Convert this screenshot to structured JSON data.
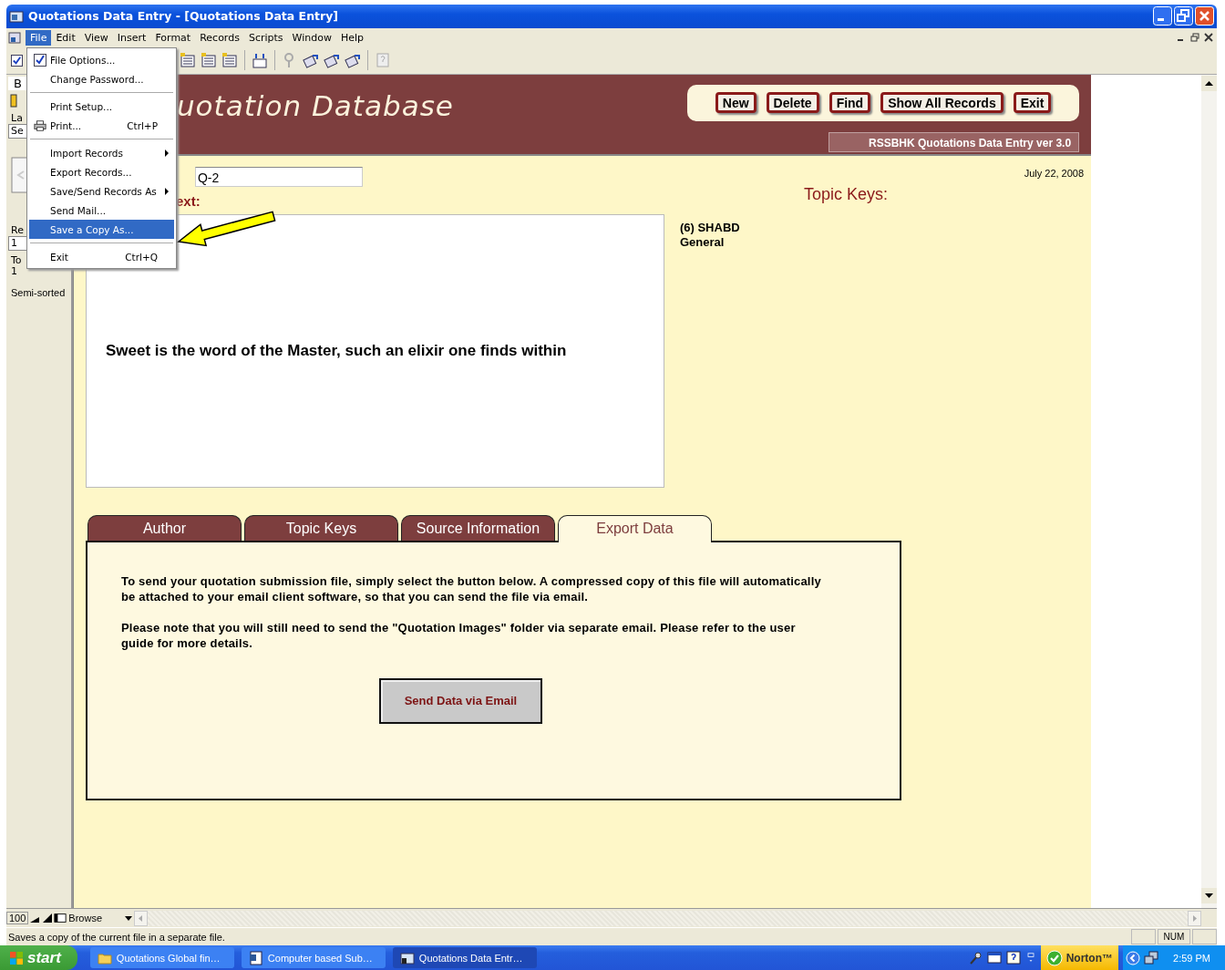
{
  "window": {
    "title": "Quotations Data Entry - [Quotations Data Entry]"
  },
  "menu_bar": [
    {
      "label": "File",
      "selected": true
    },
    {
      "label": "Edit",
      "selected": false
    },
    {
      "label": "View",
      "selected": false
    },
    {
      "label": "Insert",
      "selected": false
    },
    {
      "label": "Format",
      "selected": false
    },
    {
      "label": "Records",
      "selected": false
    },
    {
      "label": "Scripts",
      "selected": false
    },
    {
      "label": "Window",
      "selected": false
    },
    {
      "label": "Help",
      "selected": false
    }
  ],
  "file_menu": [
    {
      "kind": "check",
      "label": "File Options...",
      "checked": true,
      "submenu": false,
      "selected": false
    },
    {
      "kind": "plain",
      "label": "Change Password...",
      "submenu": false,
      "selected": false
    },
    {
      "kind": "separator"
    },
    {
      "kind": "plain",
      "label": "Print Setup...",
      "submenu": false,
      "selected": false
    },
    {
      "kind": "icon",
      "label": "Print...",
      "shortcut": "Ctrl+P",
      "submenu": false,
      "selected": false
    },
    {
      "kind": "separator"
    },
    {
      "kind": "plain",
      "label": "Import Records",
      "submenu": true,
      "selected": false
    },
    {
      "kind": "plain",
      "label": "Export Records...",
      "submenu": false,
      "selected": false
    },
    {
      "kind": "plain",
      "label": "Save/Send Records As",
      "submenu": true,
      "selected": false
    },
    {
      "kind": "plain",
      "label": "Send Mail...",
      "submenu": false,
      "selected": false
    },
    {
      "kind": "plain",
      "label": "Save a Copy As...",
      "submenu": false,
      "selected": true
    },
    {
      "kind": "separator"
    },
    {
      "kind": "plain",
      "label": "Exit",
      "shortcut": "Ctrl+Q",
      "submenu": false,
      "selected": false
    }
  ],
  "left_panel": {
    "book_tab": "B",
    "layout_label": "La",
    "layout_field": "Se",
    "record_label": "Re",
    "record_field": "1",
    "total_label": "To",
    "total_value": "1",
    "sort_status": "Semi-sorted"
  },
  "header": {
    "title": "uotation Database",
    "buttons": [
      "New",
      "Delete",
      "Find",
      "Show All Records",
      "Exit"
    ],
    "version": "RSSBHK Quotations Data Entry ver 3.0"
  },
  "form": {
    "quotation_id": "Q-2",
    "text_label": "ext:",
    "quotation_text": "Sweet is the word of the Master, such an elixir one finds within",
    "date": "July 22, 2008",
    "topic_keys_label": "Topic Keys:",
    "topic_keys": [
      "(6) SHABD",
      "General"
    ]
  },
  "tabs": [
    {
      "label": "Author",
      "selected": false
    },
    {
      "label": "Topic Keys",
      "selected": false
    },
    {
      "label": "Source Information",
      "selected": false
    },
    {
      "label": "Export Data",
      "selected": true
    }
  ],
  "export_panel": {
    "paragraphs": [
      "To send your quotation submission file, simply select the button below. A compressed copy of this file will automatically be attached to your email client software, so that you can send the file via email.",
      "Please note that you will still need to send the \"Quotation Images\" folder via separate email.  Please refer to the user guide for more details."
    ],
    "button": "Send Data via Email"
  },
  "bottom_bar": {
    "zoom": "100",
    "mode": "Browse",
    "status_text": "Saves a copy of the current file in a separate file.",
    "indicator": "NUM"
  },
  "taskbar": {
    "start": "start",
    "tasks": [
      {
        "label": "Quotations Global fin…",
        "kind": "folder",
        "selected": false
      },
      {
        "label": "Computer based Sub…",
        "kind": "document",
        "selected": false
      },
      {
        "label": "Quotations Data Entr…",
        "kind": "app",
        "selected": true
      }
    ],
    "norton": "Norton™",
    "clock": "2:59 PM"
  }
}
